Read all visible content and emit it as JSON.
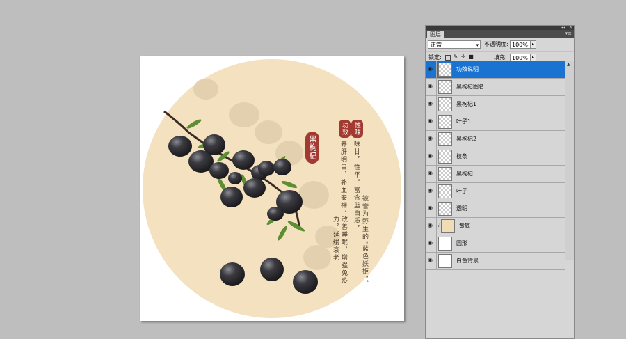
{
  "canvas_text": {
    "title": "黑枸杞",
    "badge_taste": "性味",
    "badge_effect": "功效",
    "col1": "味甘，性平。富含蓝白质，",
    "col2": "被誉为野生的\"蓝色妖姬\"。",
    "col3": "养肝明目，补血安神，",
    "col4": "改善睡眠，增强免疫力，延缓衰老"
  },
  "panel": {
    "tab_label": "图层",
    "collapse_glyph": "◂◂",
    "close_glyph": "✕",
    "menu_glyph": "▾≡",
    "blend_mode": "正常",
    "opacity_label": "不透明度:",
    "opacity_value": "100%",
    "lock_label": "锁定:",
    "fill_label": "填充:",
    "fill_value": "100%",
    "arrow_glyph": "▸",
    "dropdown_glyph": "▾"
  },
  "layers": [
    {
      "name": "功效说明",
      "selected": true,
      "thumb": "transparent"
    },
    {
      "name": "黑枸杞图名",
      "selected": false,
      "thumb": "transparent"
    },
    {
      "name": "黑枸杞1",
      "selected": false,
      "thumb": "transparent"
    },
    {
      "name": "叶子1",
      "selected": false,
      "thumb": "transparent"
    },
    {
      "name": "黑枸杞2",
      "selected": false,
      "thumb": "transparent"
    },
    {
      "name": "枝条",
      "selected": false,
      "thumb": "transparent"
    },
    {
      "name": "黑枸杞",
      "selected": false,
      "thumb": "transparent"
    },
    {
      "name": "叶子",
      "selected": false,
      "thumb": "transparent"
    },
    {
      "name": "透明",
      "selected": false,
      "thumb": "transparent"
    },
    {
      "name": "黄底",
      "selected": false,
      "thumb": "beige",
      "clipped": true
    },
    {
      "name": "圆形",
      "selected": false,
      "thumb": "white"
    },
    {
      "name": "白色背景",
      "selected": false,
      "thumb": "white"
    }
  ],
  "colors": {
    "selection": "#1a73d0",
    "circle": "#f3e1c0",
    "badge": "#a23a32",
    "berry": "#2a2a2e"
  }
}
